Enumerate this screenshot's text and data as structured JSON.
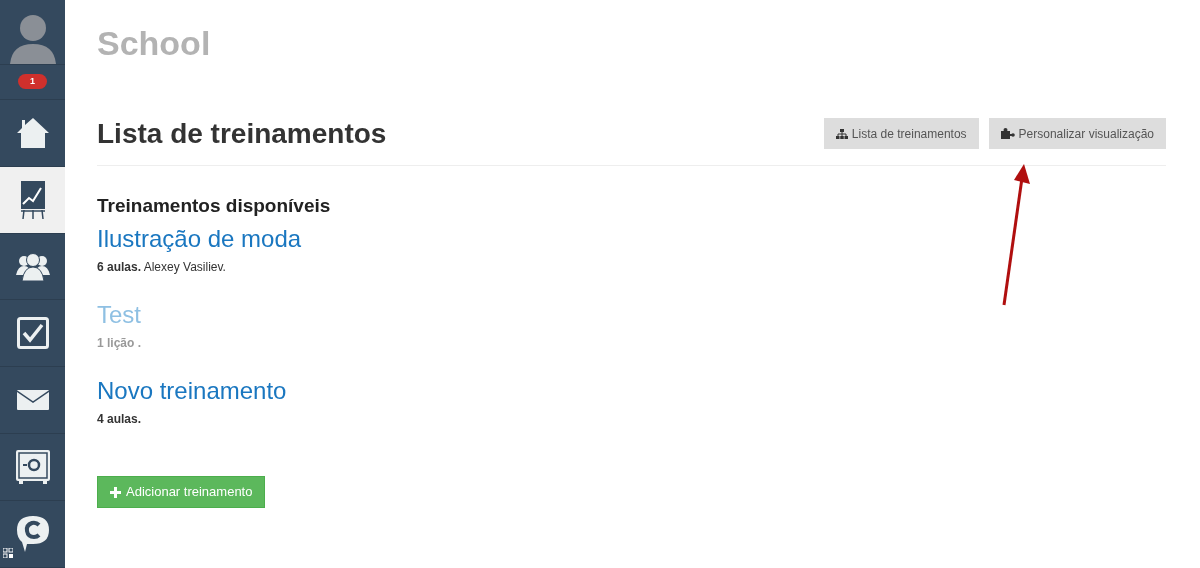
{
  "sidebar": {
    "badge": "1",
    "items": [
      {
        "kind": "home",
        "selected": false
      },
      {
        "kind": "chart",
        "selected": true
      },
      {
        "kind": "people",
        "selected": false
      },
      {
        "kind": "check",
        "selected": false
      },
      {
        "kind": "mail",
        "selected": false
      },
      {
        "kind": "safe",
        "selected": false
      },
      {
        "kind": "chat",
        "selected": false
      }
    ]
  },
  "app_title": "School",
  "page_title": "Lista de treinamentos",
  "toolbar": [
    {
      "kind": "tree",
      "label": "Lista de treinamentos"
    },
    {
      "kind": "puzzle",
      "label": "Personalizar visualização"
    }
  ],
  "section_title": "Treinamentos disponíveis",
  "trainings": [
    {
      "title": "Ilustração de moda",
      "meta": "**6 aulas.** Alexey Vasiliev.",
      "disabled": false
    },
    {
      "title": "Test",
      "meta": "1 lição .",
      "disabled": true
    },
    {
      "title": "Novo treinamento",
      "meta": "**4 aulas.**",
      "disabled": false
    }
  ],
  "add_button": "Adicionar treinamento"
}
